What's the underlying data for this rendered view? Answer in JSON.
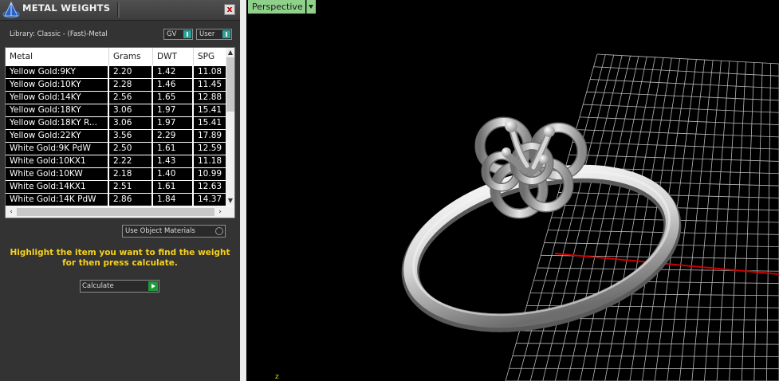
{
  "panel": {
    "title": "METAL WEIGHTS",
    "close_label": "x",
    "library": "Library: Classic - (Fast)-Metal",
    "toggles": {
      "gv": "GV",
      "user": "User"
    },
    "table": {
      "columns": [
        "Metal",
        "Grams",
        "DWT",
        "SPG"
      ],
      "rows": [
        [
          "Yellow Gold:9KY",
          "2.20",
          "1.42",
          "11.08"
        ],
        [
          "Yellow Gold:10KY",
          "2.28",
          "1.46",
          "11.45"
        ],
        [
          "Yellow Gold:14KY",
          "2.56",
          "1.65",
          "12.88"
        ],
        [
          "Yellow Gold:18KY",
          "3.06",
          "1.97",
          "15.41"
        ],
        [
          "Yellow Gold:18KY R...",
          "3.06",
          "1.97",
          "15.41"
        ],
        [
          "Yellow Gold:22KY",
          "3.56",
          "2.29",
          "17.89"
        ],
        [
          "White Gold:9K PdW",
          "2.50",
          "1.61",
          "12.59"
        ],
        [
          "White Gold:10KX1",
          "2.22",
          "1.43",
          "11.18"
        ],
        [
          "White Gold:10KW",
          "2.18",
          "1.40",
          "10.99"
        ],
        [
          "White Gold:14KX1",
          "2.51",
          "1.61",
          "12.63"
        ],
        [
          "White Gold:14K PdW",
          "2.86",
          "1.84",
          "14.37"
        ]
      ]
    },
    "use_object_materials": "Use Object Materials",
    "hint": "Highlight the item you want to find the weight for then press calculate.",
    "calculate": "Calculate"
  },
  "viewport": {
    "view_name": "Perspective",
    "axis_label": "z"
  },
  "colors": {
    "panel_bg": "#333333",
    "hint_text": "#f7d21b",
    "viewport_label_bg": "#8fd18b",
    "grid": "#b8b8b8",
    "axis_x": "#cc0000"
  }
}
